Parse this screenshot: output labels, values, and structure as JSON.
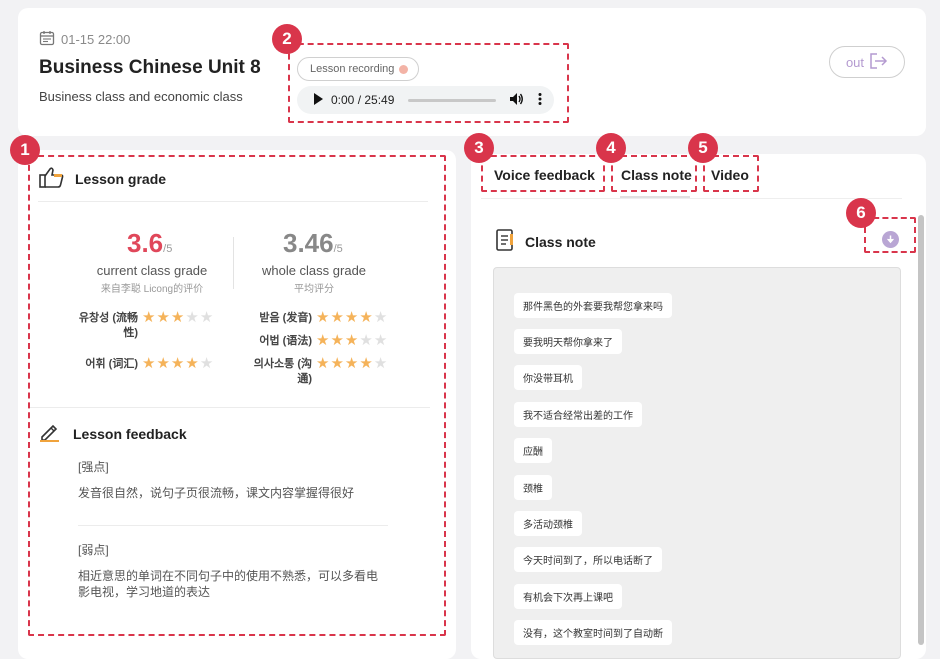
{
  "header": {
    "datetime": "01-15 22:00",
    "title": "Business Chinese Unit 8",
    "subtitle": "Business class and economic class",
    "recording_label": "Lesson recording",
    "audio_time": "0:00 / 25:49",
    "out_label": "out"
  },
  "badges": [
    "1",
    "2",
    "3",
    "4",
    "5",
    "6"
  ],
  "grade": {
    "title": "Lesson grade",
    "current_value": "3.6",
    "current_max": "/5",
    "current_label": "current class grade",
    "current_sub": "来自李聪 Licong的评价",
    "whole_value": "3.46",
    "whole_max": "/5",
    "whole_label": "whole class grade",
    "whole_sub": "平均评分",
    "skills": [
      {
        "label": "유창성 (流畅性)",
        "stars": 3
      },
      {
        "label": "받음 (发音)",
        "stars": 4
      },
      {
        "label": "어법 (语法)",
        "stars": 3
      },
      {
        "label": "어휘 (词汇)",
        "stars": 4
      },
      {
        "label": "의사소통 (沟通)",
        "stars": 4
      }
    ]
  },
  "feedback": {
    "title": "Lesson feedback",
    "strengths_heading": "[强点]",
    "strengths_text": "发音很自然，说句子页很流畅，课文内容掌握得很好",
    "weakness_heading": "[弱点]",
    "weakness_text_1": "相近意思的单词在不同句子中的使用不熟悉，可以多看电",
    "weakness_text_2": "影电视，学习地道的表达"
  },
  "tabs": {
    "voice_feedback": "Voice feedback",
    "class_note": "Class note",
    "video": "Video"
  },
  "class_note": {
    "title": "Class note",
    "items": [
      "那件黑色的外套要我帮您拿来吗",
      "要我明天帮你拿来了",
      "你没带耳机",
      "我不适合经常出差的工作",
      "应酬",
      "颈椎",
      "多活动颈椎",
      "今天时间到了，所以电话断了",
      "有机会下次再上课吧",
      "没有，这个教室时间到了自动断"
    ]
  },
  "colors": {
    "highlight": "#d9354b",
    "current_grade": "#e0475a",
    "whole_grade": "#888888",
    "star_on": "#f5b35a",
    "accent_purple": "#b9a6d4"
  }
}
